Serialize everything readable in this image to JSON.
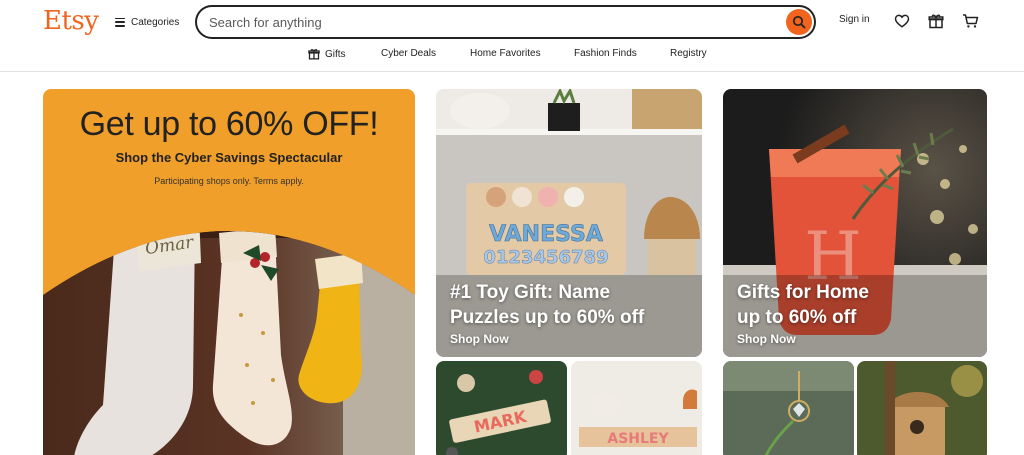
{
  "header": {
    "logo": "Etsy",
    "categories_label": "Categories",
    "search_placeholder": "Search for anything",
    "signin_label": "Sign in",
    "icons": [
      "heart-icon",
      "gift-icon",
      "cart-icon"
    ]
  },
  "nav": {
    "items": [
      {
        "label": "Gifts",
        "icon": "gift-icon"
      },
      {
        "label": "Cyber Deals"
      },
      {
        "label": "Home Favorites"
      },
      {
        "label": "Fashion Finds"
      },
      {
        "label": "Registry"
      }
    ]
  },
  "promo": {
    "title": "Get up to 60% OFF!",
    "subtitle": "Shop the Cyber Savings Spectacular",
    "note": "Participating shops only. Terms apply.",
    "stocking_name": "Omar"
  },
  "cards": [
    {
      "title_line1": "#1 Toy Gift: Name",
      "title_line2": "Puzzles up to 60% off",
      "cta": "Shop Now",
      "puzzle_name": "VANESSA",
      "puzzle_digits": "0123456789"
    },
    {
      "title_line1": "Gifts for Home",
      "title_line2": "up to 60% off",
      "cta": "Shop Now",
      "glass_letter": "H"
    }
  ],
  "small_cards": [
    {
      "name": "MARK"
    },
    {
      "name": "ASHLEY"
    },
    {},
    {}
  ],
  "colors": {
    "brand": "#f1641e",
    "promo_bg": "#f09f2a",
    "text": "#222222"
  }
}
